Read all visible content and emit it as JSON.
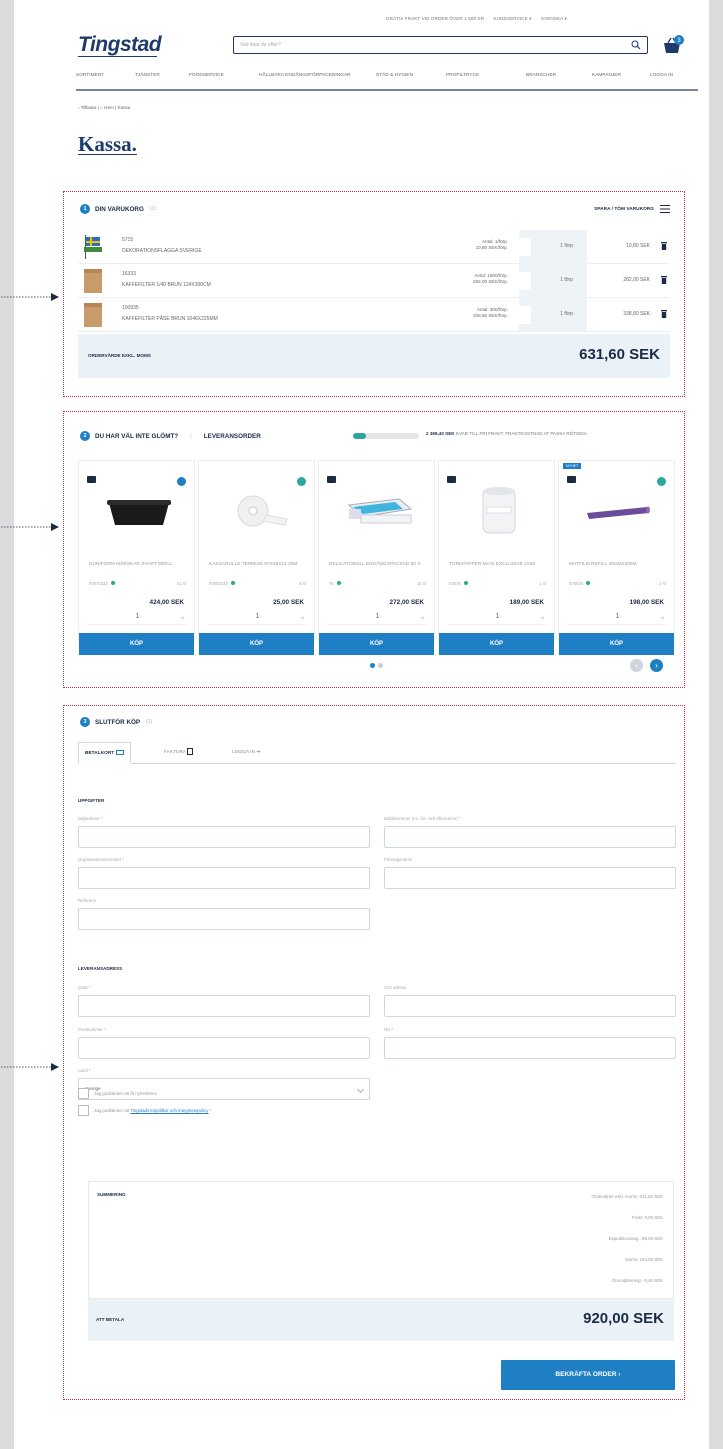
{
  "header": {
    "logo": "Tingstad",
    "topbar": [
      "GRATIS FRAKT VID ORDER ÖVER 1 500 KR",
      "KUNDSERVICE ▾",
      "SVENSKA ▾"
    ],
    "search_placeholder": "Vad letar du efter?",
    "cart_count": "3"
  },
  "nav": {
    "items": [
      "SORTIMENT",
      "TJÄNSTER",
      "FOODSERVICE",
      "HÅLLBARA ENGÅNGSFÖRPACKNINGAR",
      "STÄD & HYGIEN",
      "PROFILTRYCK",
      "BRANSCHER",
      "KAMPANJER",
      "LOGGA IN"
    ]
  },
  "breadcrumb": "‹ Tillbaka  |  ⌂ Hem  |  Kassa",
  "page_title": "Kassa.",
  "cart": {
    "step": "1",
    "heading": "DIN VARUKORG",
    "heading_muted": "(3)",
    "save_empty": "SPARA / TÖM VARUKORG",
    "rows": [
      {
        "sku": "5715",
        "name": "DEKORATIONSFLAGGA SVERIGE",
        "unit": "Antal: 1/förp.\n10,80 SEK/förp.",
        "qty": "1 förp",
        "price": "10,80 SEK"
      },
      {
        "sku": "16333",
        "name": "KAFFEFILTER 1/40 BRUN 124X300CM",
        "unit": "Antal: 1000/förp.\n282,00 SEK/förp.",
        "qty": "1 förp",
        "price": "282,00 SEK"
      },
      {
        "sku": "100935",
        "name": "KAFFEFILTER PÅSE BRUN 1046X225MM",
        "unit": "Antal: 300/förp.\n338,80 SEK/förp.",
        "qty": "1 förp",
        "price": "338,80 SEK"
      }
    ],
    "footer_label": "ORDERVÄRDE EXKL. MOMS",
    "total": "631,60 SEK"
  },
  "upsell": {
    "step": "2",
    "heading": "DU HAR VÄL INTE GLÖMT?",
    "tab2": "LEVERANSORDER",
    "freight_amount": "2 368,40 SEK",
    "freight_text": "KVAR TILL FRI FRAKT. FRAKTKOSTNAD AT PASSA RÖTSIDA.",
    "progress": 0.2,
    "buy_label": "KÖP",
    "products": [
      {
        "name": "DUNIFORM MÅRSKAR SVART 900CL",
        "sku": "00076333",
        "stock": "21 st",
        "price": "424,00 SEK",
        "qty": "1",
        "unit": "st",
        "badge": "",
        "img": "black-tray"
      },
      {
        "name": "KASSARULLE TERMISK 57X46X12 20M",
        "sku": "00002333",
        "stock": "8 st",
        "price": "25,00 SEK",
        "qty": "1",
        "unit": "st",
        "badge": "",
        "img": "roll"
      },
      {
        "name": "DELICATOBOLL ENGÅNGSPACKAD 90 X",
        "sku": "76",
        "stock": "18 st",
        "price": "272,00 SEK",
        "qty": "1",
        "unit": "st",
        "badge": "",
        "img": "box-blue"
      },
      {
        "name": "TORKPAPPER MAXI EXCLUSIVE 1x50",
        "sku": "03076",
        "stock": "1 st",
        "price": "189,00 SEK",
        "qty": "1",
        "unit": "st",
        "badge": "",
        "img": "paper-roll"
      },
      {
        "name": "MATFILM REFILL 45CMX300M",
        "sku": "675636",
        "stock": "2 st",
        "price": "198,00 SEK",
        "qty": "1",
        "unit": "st",
        "badge": "NYHET",
        "img": "film"
      }
    ]
  },
  "checkout": {
    "step": "3",
    "heading": "SLUTFÖR KÖP",
    "heading_muted": "(3)",
    "tabs": [
      "BETALKORT",
      "FAKTURA",
      "LOGGA IN"
    ],
    "details_heading": "UPPGIFTER",
    "details_fields": {
      "email": "Mejladress *",
      "phone": "Mobilnummer (ex. för- och efternamn) *",
      "org": "Organisationsnummer *",
      "company": "Företagsnamn",
      "ref": "Referens"
    },
    "delivery_heading": "LEVERANSADRESS",
    "delivery_fields": {
      "address": "Gata *",
      "co": "C/O adress",
      "zip": "Postnummer *",
      "city": "Ort *",
      "country_label": "Land *",
      "country_value": "Sverige"
    },
    "newsletter": "Jag godkänner att få nyhetsbrev",
    "terms_prefix": "Jag godkänner att ",
    "terms_link": "Tingstads köpvillkor och integritetspolicy",
    "terms_suffix": " *",
    "summary_heading": "SUMMERING",
    "summary_lines": [
      "Ordervärde exkl. moms: 631,60 SEK",
      "Frakt: 0,00 SEK",
      "Expeditionsavg.: 99,00 SEK",
      "Moms: 184,00 SEK",
      "Öresutjämning: -0,40 SEK"
    ],
    "pay_label": "ATT BETALA",
    "pay_total": "920,00 SEK",
    "confirm": "BEKRÄFTA ORDER ›"
  },
  "colors": {
    "brand": "#1c3a6b",
    "accent": "#1f7fc4",
    "frame": "#c4303d"
  }
}
